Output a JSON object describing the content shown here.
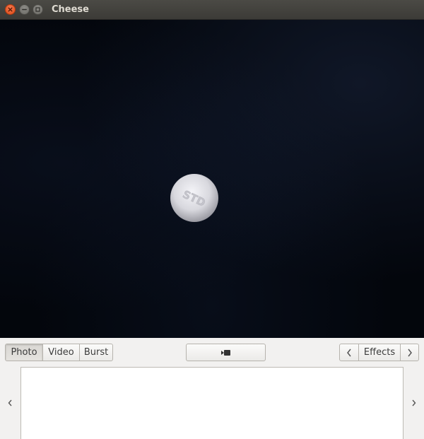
{
  "window": {
    "title": "Cheese"
  },
  "viewport": {
    "pill_imprint": "STD"
  },
  "toolbar": {
    "modes": [
      {
        "label": "Photo",
        "active": true
      },
      {
        "label": "Video",
        "active": false
      },
      {
        "label": "Burst",
        "active": false
      }
    ],
    "record_icon": "camera-icon",
    "effects_label": "Effects"
  },
  "thumbnails": {
    "items": []
  },
  "colors": {
    "titlebar": "#3c3b37",
    "close_button": "#df4a16",
    "viewport_background": "#03060c",
    "panel_background": "#f2f1f0"
  }
}
